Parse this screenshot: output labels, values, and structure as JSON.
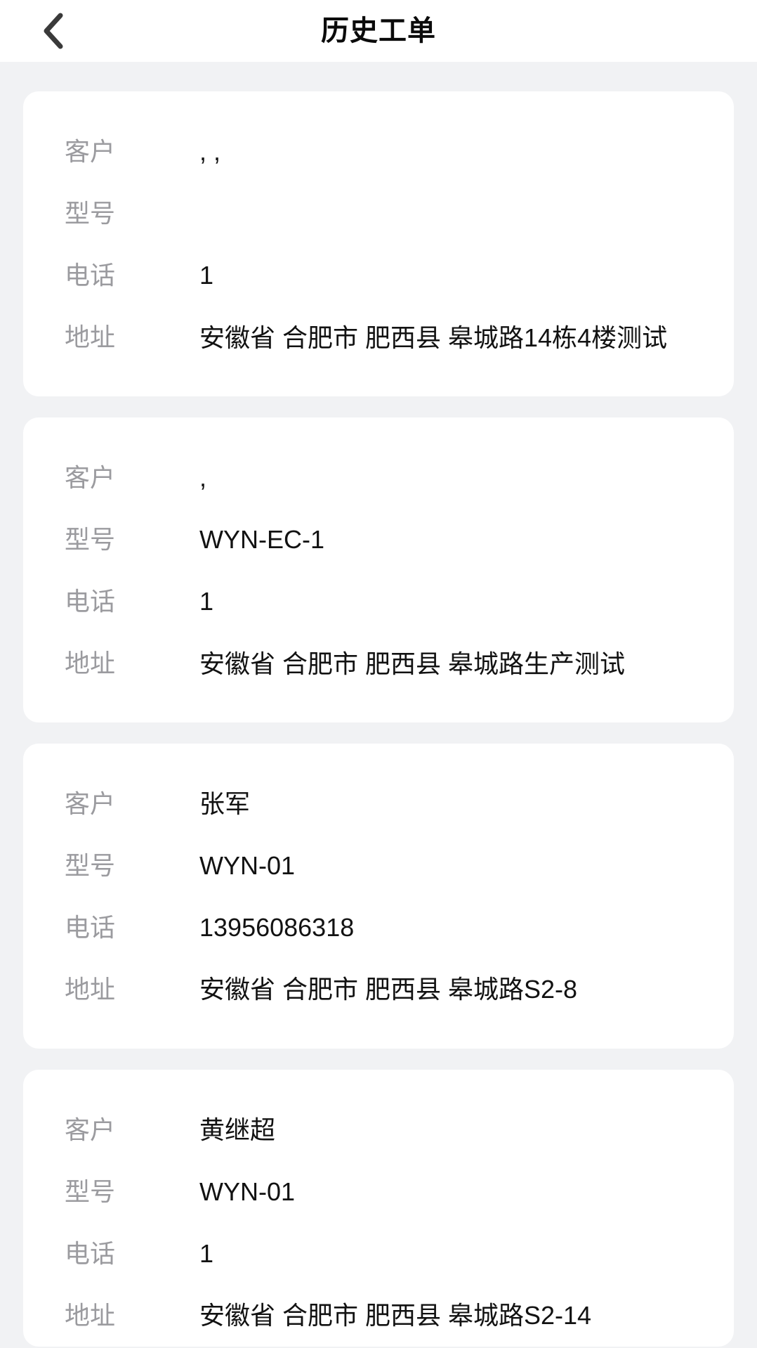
{
  "header": {
    "title": "历史工单",
    "back_icon": "chevron-left-icon"
  },
  "labels": {
    "customer": "客户",
    "model": "型号",
    "phone": "电话",
    "address": "地址"
  },
  "colors": {
    "page_background": "#f1f2f4",
    "card_background": "#ffffff",
    "label_text": "#9b9b9f",
    "value_text": "#121212",
    "title_text": "#0b0b0b"
  },
  "cards": [
    {
      "customer": ", ,",
      "model": "",
      "phone": "1",
      "address": "安徽省 合肥市 肥西县 皋城路14栋4楼测试"
    },
    {
      "customer": ",",
      "model": "WYN-EC-1",
      "phone": "1",
      "address": "安徽省 合肥市 肥西县 皋城路生产测试"
    },
    {
      "customer": "张军",
      "model": "WYN-01",
      "phone": "13956086318",
      "address": "安徽省 合肥市 肥西县 皋城路S2-8"
    },
    {
      "customer": "黄继超",
      "model": "WYN-01",
      "phone": "1",
      "address": "安徽省 合肥市 肥西县 皋城路S2-14"
    }
  ]
}
